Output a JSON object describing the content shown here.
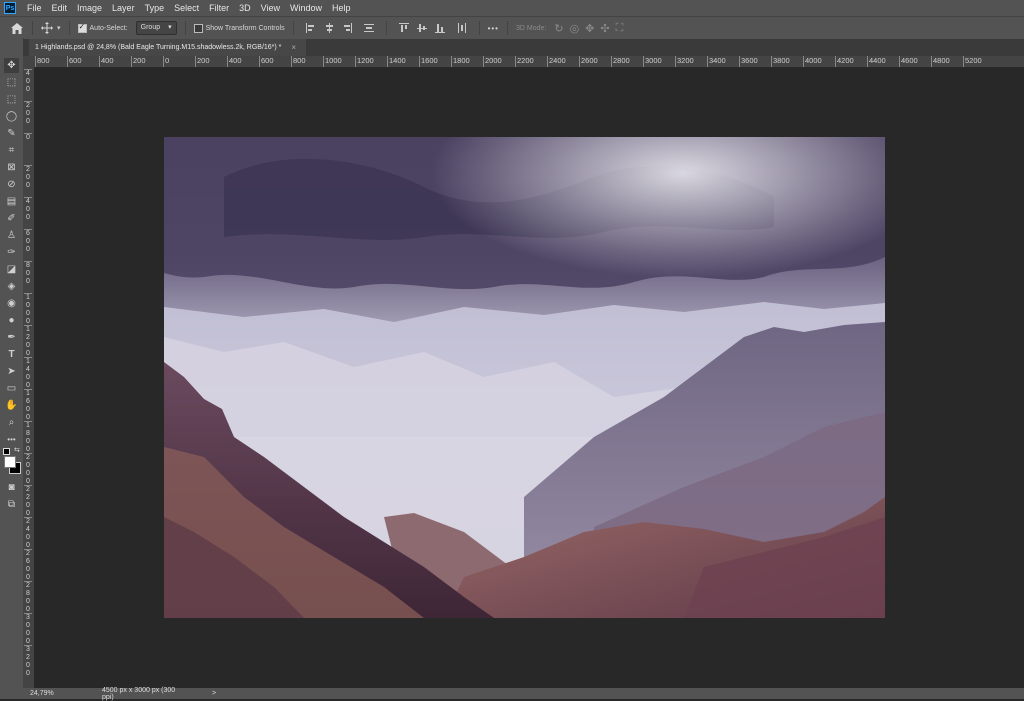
{
  "menu": [
    "File",
    "Edit",
    "Image",
    "Layer",
    "Type",
    "Select",
    "Filter",
    "3D",
    "View",
    "Window",
    "Help"
  ],
  "app_logo": "Ps",
  "options": {
    "auto_select_label": "Auto-Select:",
    "auto_select_checked": true,
    "auto_select_target": "Group",
    "transform_label": "Show Transform Controls",
    "transform_checked": false,
    "more_label": "•••",
    "mode_3d_label": "3D Mode:"
  },
  "tab": {
    "title": "1 Highlands.psd @ 24,8% (Bald Eagle Turning.M15.shadowless.2k, RGB/16*) *",
    "close": "×"
  },
  "ruler": {
    "h_labels": [
      "800",
      "600",
      "400",
      "200",
      "0",
      "200",
      "400",
      "600",
      "800",
      "1000",
      "1200",
      "1400",
      "1600",
      "1800",
      "2000",
      "2200",
      "2400",
      "2600",
      "2800",
      "3000",
      "3200",
      "3400",
      "3600",
      "3800",
      "4000",
      "4200",
      "4400",
      "4600",
      "4800",
      "5200"
    ],
    "v_labels": [
      "400",
      "200",
      "0",
      "200",
      "400",
      "600",
      "800",
      "1000",
      "1200",
      "1400",
      "1600",
      "1800",
      "2000",
      "2200",
      "2400",
      "2600",
      "2800",
      "3000",
      "3200"
    ]
  },
  "status": {
    "zoom": "24,79%",
    "doc_info": "4500 px x 3000 px (300 ppi)",
    "arrow": ">"
  },
  "colors": {
    "ui_panel": "#535353",
    "canvas_bg": "#282828",
    "accent": "#31a8ff"
  }
}
